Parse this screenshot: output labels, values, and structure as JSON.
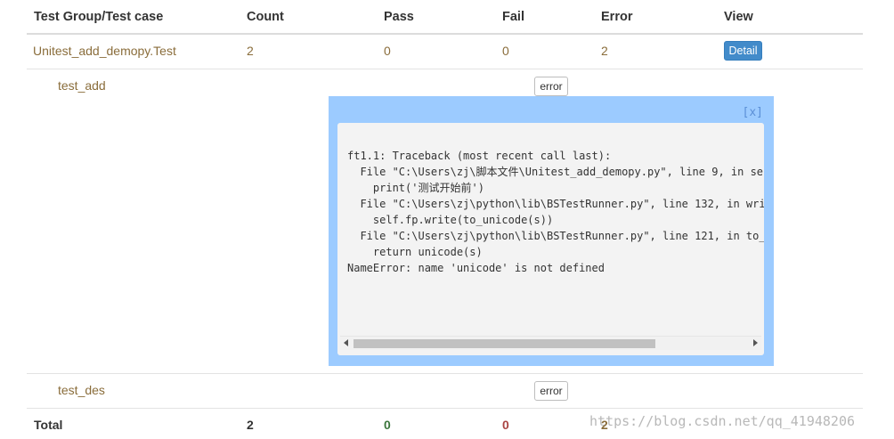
{
  "table": {
    "headers": [
      "Test Group/Test case",
      "Count",
      "Pass",
      "Fail",
      "Error",
      "View"
    ],
    "class_row": {
      "name": "Unitest_add_demopy.Test",
      "count": "2",
      "pass": "0",
      "fail": "0",
      "error": "2",
      "detail_label": "Detail"
    },
    "cases": [
      {
        "name": "test_add",
        "status_label": "error"
      },
      {
        "name": "test_des",
        "status_label": "error"
      }
    ],
    "total_row": {
      "label": "Total",
      "count": "2",
      "pass": "0",
      "fail": "0",
      "error": "2"
    }
  },
  "popup": {
    "close_label": "[x]",
    "trace_lines": [
      "ft1.1: Traceback (most recent call last):",
      "  File \"C:\\Users\\zj\\脚本文件\\Unitest_add_demopy.py\", line 9, in se",
      "    print('测试开始前')",
      "  File \"C:\\Users\\zj\\python\\lib\\BSTestRunner.py\", line 132, in writ",
      "    self.fp.write(to_unicode(s))",
      "  File \"C:\\Users\\zj\\python\\lib\\BSTestRunner.py\", line 121, in to_u",
      "    return unicode(s)",
      "NameError: name 'unicode' is not defined"
    ],
    "scroll_fraction": 0.85
  },
  "watermark": "https://blog.csdn.net/qq_41948206",
  "colors": {
    "detail_button": "#428bca",
    "popup_background": "#9ccbff",
    "pass_green": "#3c763d",
    "fail_red": "#a94442",
    "error_orange": "#8a6d3b"
  }
}
